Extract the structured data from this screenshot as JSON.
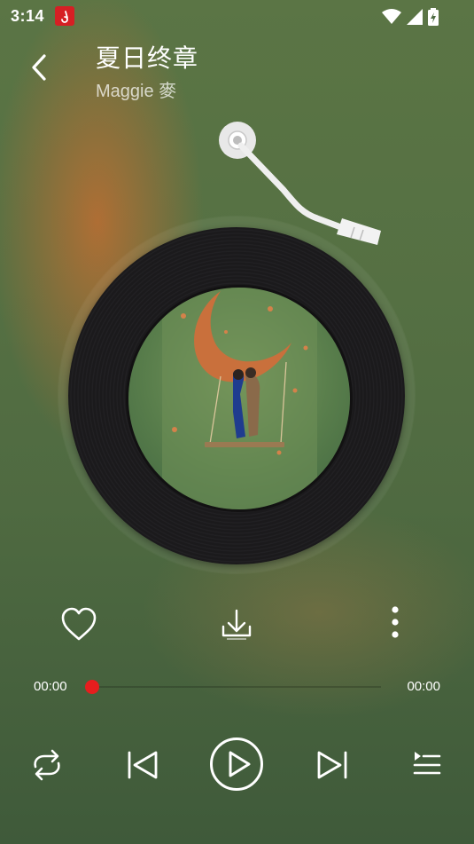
{
  "status_bar": {
    "time": "3:14",
    "icons": [
      "app-notification-icon",
      "wifi-icon",
      "signal-icon",
      "battery-icon"
    ]
  },
  "header": {
    "title": "夏日终章",
    "artist": "Maggie 麥"
  },
  "player": {
    "current_time": "00:00",
    "total_time": "00:00",
    "progress_percent": 0,
    "state": "paused"
  },
  "actions": [
    "heart-icon",
    "download-icon",
    "more-vertical-icon"
  ],
  "controls": [
    "repeat-icon",
    "skip-previous-icon",
    "play-icon",
    "skip-next-icon",
    "playlist-icon"
  ],
  "colors": {
    "accent": "#e61e1e",
    "background": "#557043",
    "disc": "#1b1a1c"
  }
}
